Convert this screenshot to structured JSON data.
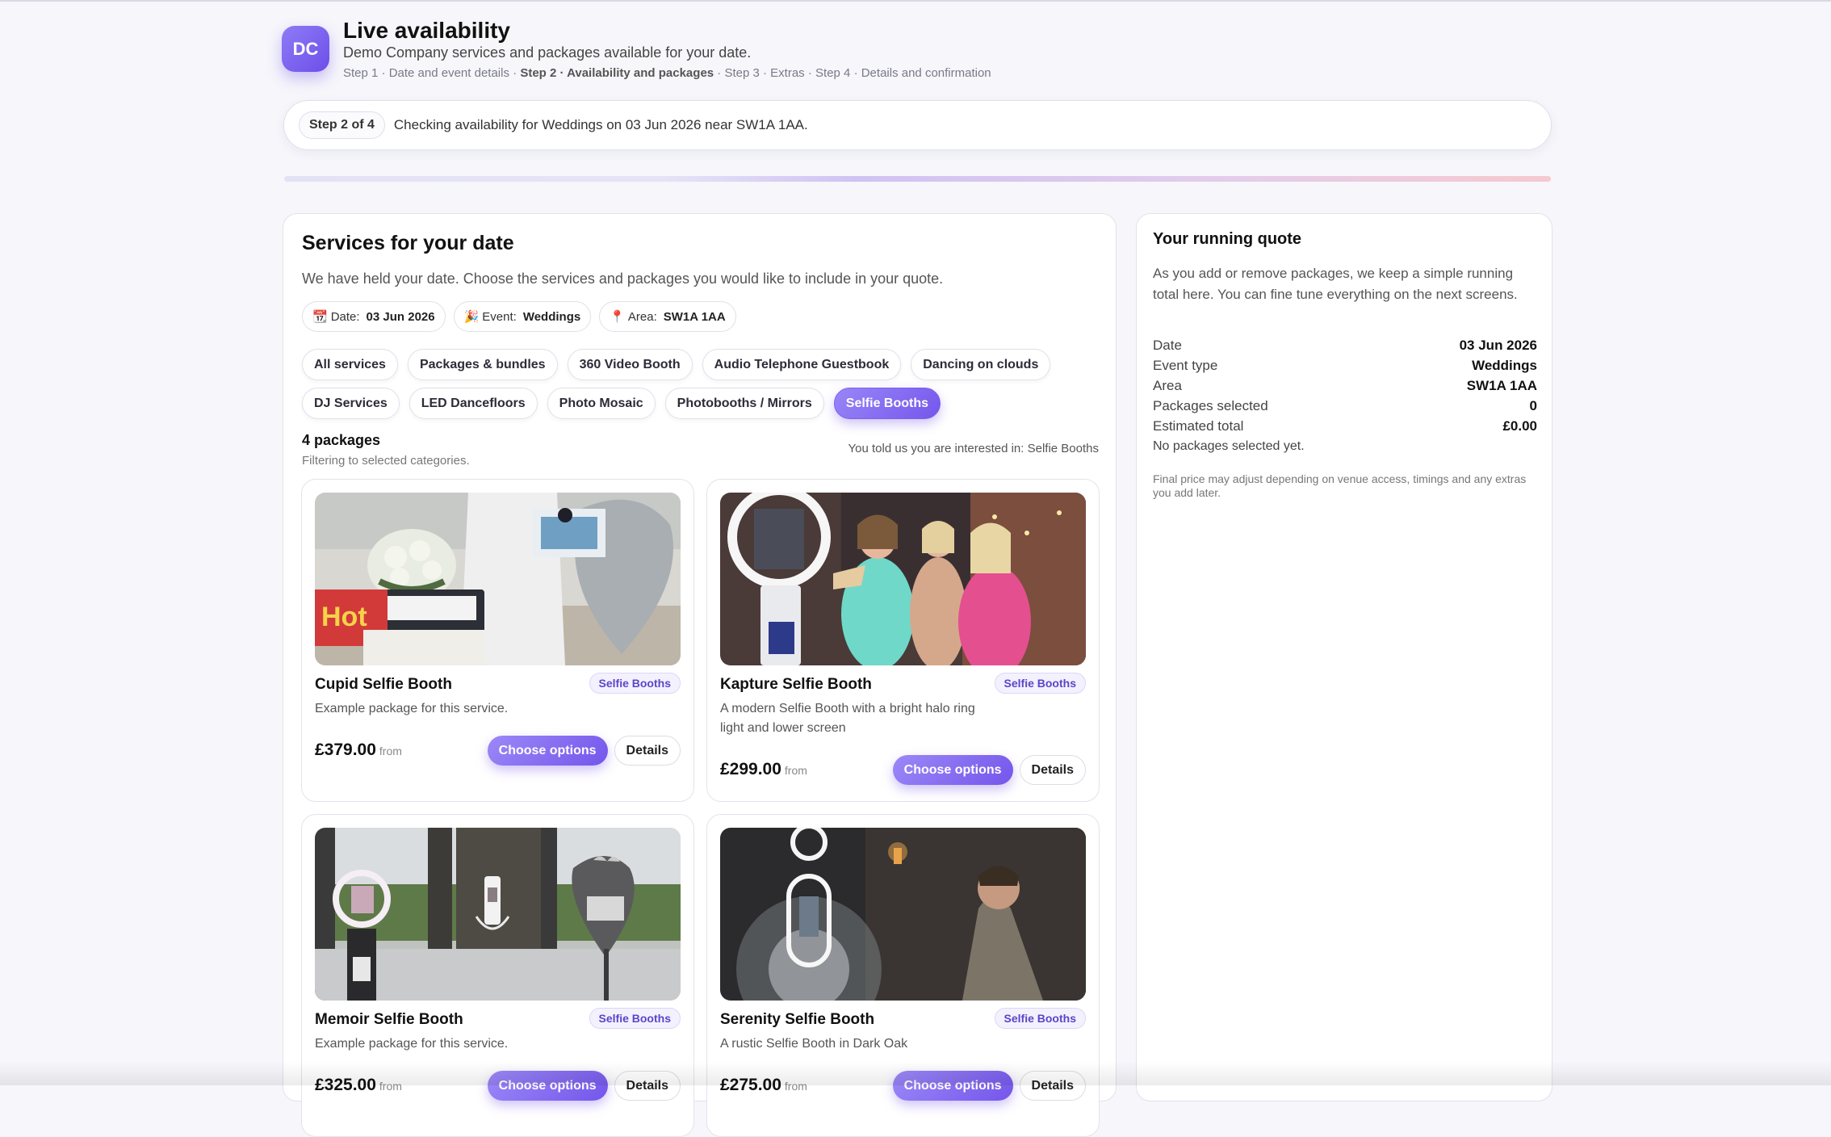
{
  "header": {
    "logo_text": "DC",
    "title": "Live availability",
    "subtitle": "Demo Company services and packages available for your date.",
    "steps": [
      {
        "label": "Step 1 · Date and event details",
        "active": false
      },
      {
        "label": "Step 2 · Availability and packages",
        "active": true
      },
      {
        "label": "Step 3 · Extras",
        "active": false
      },
      {
        "label": "Step 4 · Details and confirmation",
        "active": false
      }
    ],
    "separator": " · "
  },
  "stepbar": {
    "pill": "Step 2 of 4",
    "text": "Checking availability for Weddings on 03 Jun 2026 near SW1A 1AA."
  },
  "services": {
    "title": "Services for your date",
    "description": "We have held your date. Choose the services and packages you would like to include in your quote.",
    "info": {
      "date_icon": "📆",
      "date_label": "Date:",
      "date_value": "03 Jun 2026",
      "event_icon": "🎉",
      "event_label": "Event:",
      "event_value": "Weddings",
      "area_icon": "📍",
      "area_label": "Area:",
      "area_value": "SW1A 1AA"
    },
    "categories_row1": [
      "All services",
      "Packages & bundles",
      "360 Video Booth",
      "Audio Telephone Guestbook",
      "Dancing on clouds"
    ],
    "categories_row2": [
      "DJ Services",
      "LED Dancefloors",
      "Photo Mosaic",
      "Photobooths / Mirrors",
      "Selfie Booths"
    ],
    "active_category": "Selfie Booths",
    "count_label": "4 packages",
    "filtering_note": "Filtering to selected categories.",
    "interest_note": "You told us you are interested in: Selfie Booths",
    "packages": [
      {
        "name": "Cupid Selfie Booth",
        "badge": "Selfie Booths",
        "description": "Example package for this service.",
        "price": "£379.00",
        "price_suffix": "from",
        "choose_label": "Choose options",
        "details_label": "Details"
      },
      {
        "name": "Kapture Selfie Booth",
        "badge": "Selfie Booths",
        "description": "A modern Selfie Booth with a bright halo ring light and lower screen",
        "price": "£299.00",
        "price_suffix": "from",
        "choose_label": "Choose options",
        "details_label": "Details"
      },
      {
        "name": "Memoir Selfie Booth",
        "badge": "Selfie Booths",
        "description": "Example package for this service.",
        "price": "£325.00",
        "price_suffix": "from",
        "choose_label": "Choose options",
        "details_label": "Details"
      },
      {
        "name": "Serenity Selfie Booth",
        "badge": "Selfie Booths",
        "description": "A rustic Selfie Booth in Dark Oak",
        "price": "£275.00",
        "price_suffix": "from",
        "choose_label": "Choose options",
        "details_label": "Details"
      }
    ]
  },
  "quote": {
    "title": "Your running quote",
    "description": "As you add or remove packages, we keep a simple running total here. You can fine tune everything on the next screens.",
    "rows": [
      {
        "label": "Date",
        "value": "03 Jun 2026"
      },
      {
        "label": "Event type",
        "value": "Weddings"
      },
      {
        "label": "Area",
        "value": "SW1A 1AA"
      },
      {
        "label": "Packages selected",
        "value": "0"
      },
      {
        "label": "Estimated total",
        "value": "£0.00"
      }
    ],
    "empty_note": "No packages selected yet.",
    "footnote": "Final price may adjust depending on venue access, timings and any extras you add later."
  },
  "colors": {
    "accent": "#7557ec",
    "accent_light": "#9a86f7",
    "badge_bg": "#f4f1fe",
    "badge_text": "#5b45c9",
    "page_bg": "#f6f6fb"
  }
}
